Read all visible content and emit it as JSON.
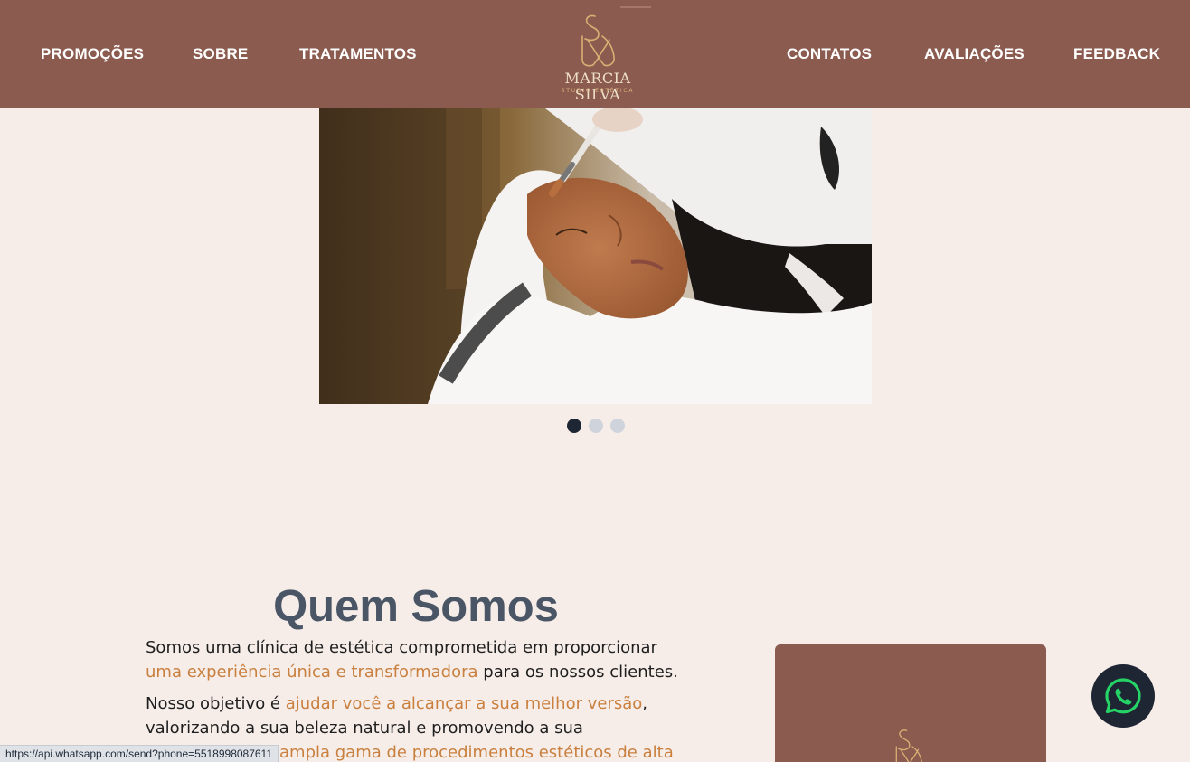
{
  "nav": {
    "left": [
      "PROMOÇÕES",
      "SOBRE",
      "TRATAMENTOS"
    ],
    "right": [
      "CONTATOS",
      "AVALIAÇÕES",
      "FEEDBACK"
    ]
  },
  "logo": {
    "name": "MARCIA SILVA",
    "subtitle": "STUDIO ESTÉTICA"
  },
  "hero": {
    "slide_count": 3,
    "active_slide": 1
  },
  "about": {
    "title": "Quem Somos",
    "p1_a": "Somos uma clínica de estética comprometida em proporcionar ",
    "p1_hl": "uma experiência única e transformadora",
    "p1_b": " para os nossos clientes.",
    "p2_a": "Nosso objetivo é ",
    "p2_hl": "ajudar você a alcançar a sua melhor versão",
    "p2_b": ", valorizando a sua beleza natural e promovendo a sua autoconfiança.",
    "p3_hl": "ampla gama de procedimentos estéticos de alta"
  },
  "whatsapp": {
    "icon": "whatsapp-icon"
  },
  "status_url": "https://api.whatsapp.com/send?phone=5518998087611",
  "colors": {
    "header": "#8b5b4f",
    "background": "#f6ede9",
    "accent": "#c97f3d",
    "title": "#4a5565",
    "dot_active": "#1e2533",
    "dot_inactive": "#cfd3dc"
  }
}
